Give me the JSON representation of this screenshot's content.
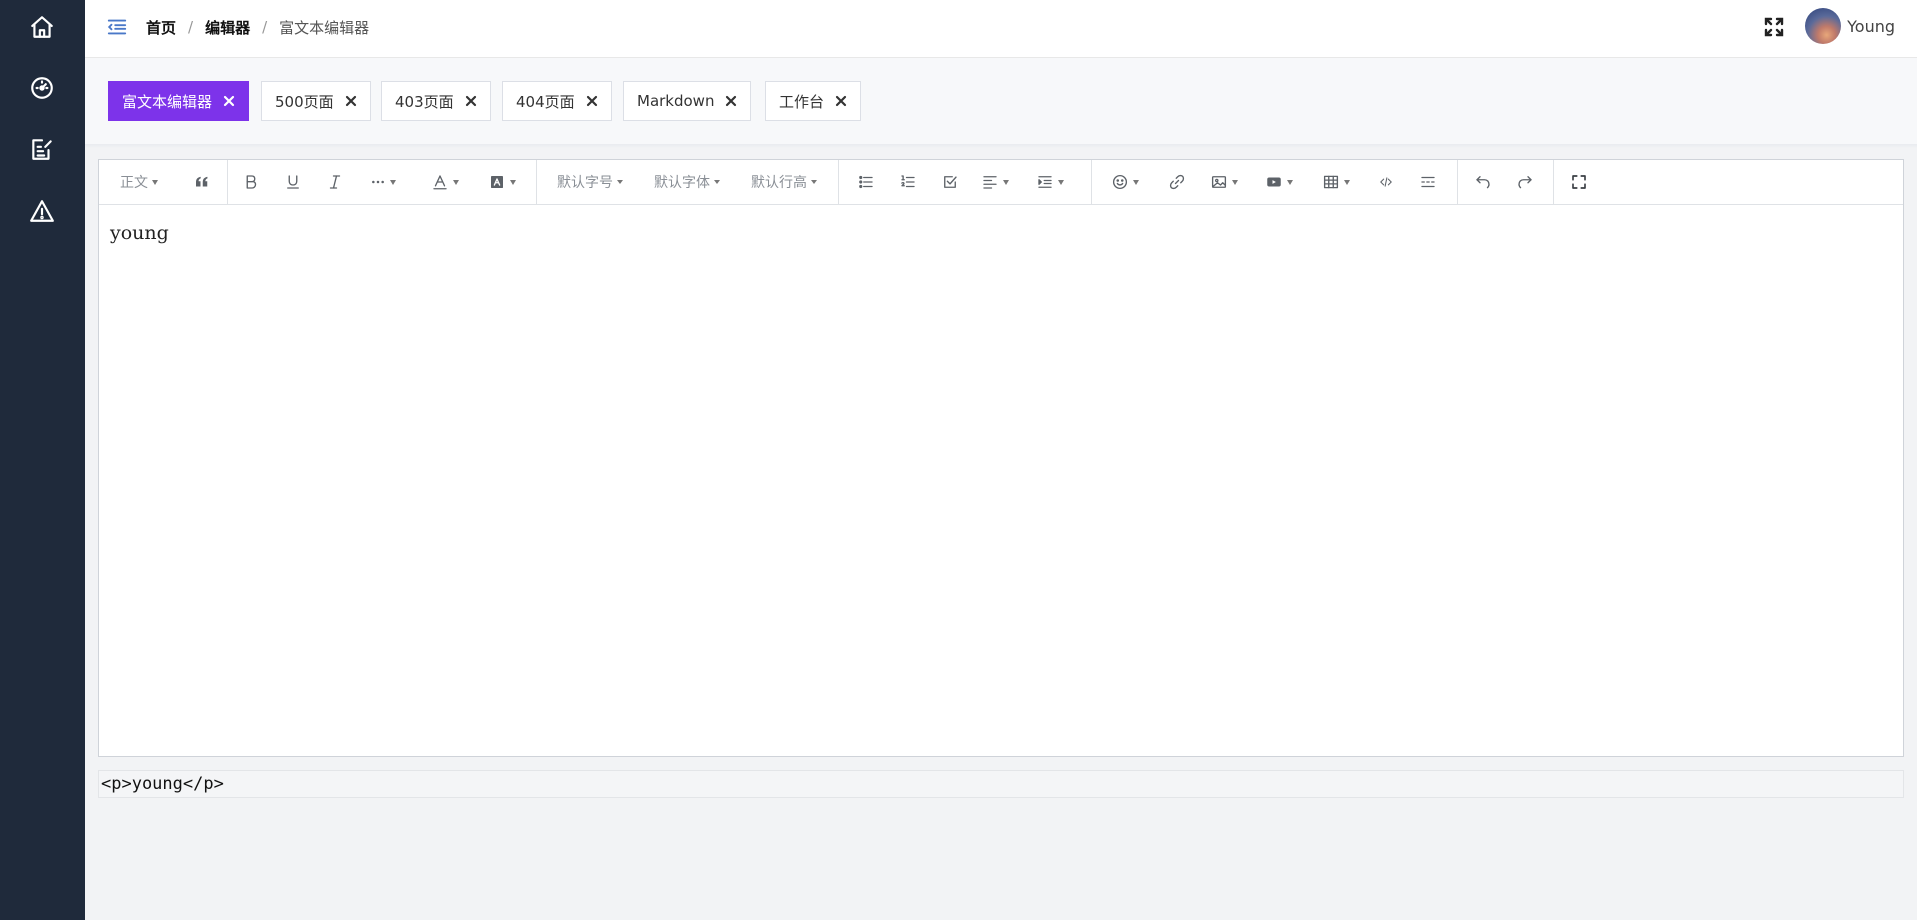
{
  "sidebar": {
    "items": [
      {
        "icon": "home-icon"
      },
      {
        "icon": "dashboard-icon"
      },
      {
        "icon": "editor-icon"
      },
      {
        "icon": "warning-icon"
      }
    ]
  },
  "header": {
    "breadcrumb": [
      "首页",
      "编辑器",
      "富文本编辑器"
    ],
    "username": "Young"
  },
  "tags": [
    {
      "label": "富文本编辑器",
      "active": true
    },
    {
      "label": "500页面",
      "active": false
    },
    {
      "label": "403页面",
      "active": false
    },
    {
      "label": "404页面",
      "active": false
    },
    {
      "label": "Markdown",
      "active": false
    },
    {
      "label": "工作台",
      "active": false
    }
  ],
  "toolbar": {
    "header_label": "正文",
    "font_size_label": "默认字号",
    "font_family_label": "默认字体",
    "line_height_label": "默认行高"
  },
  "editor": {
    "content": "young",
    "html_output": "<p>young</p>"
  },
  "colors": {
    "sidebar_bg": "#1f2a3b",
    "accent": "#7d33ea"
  }
}
